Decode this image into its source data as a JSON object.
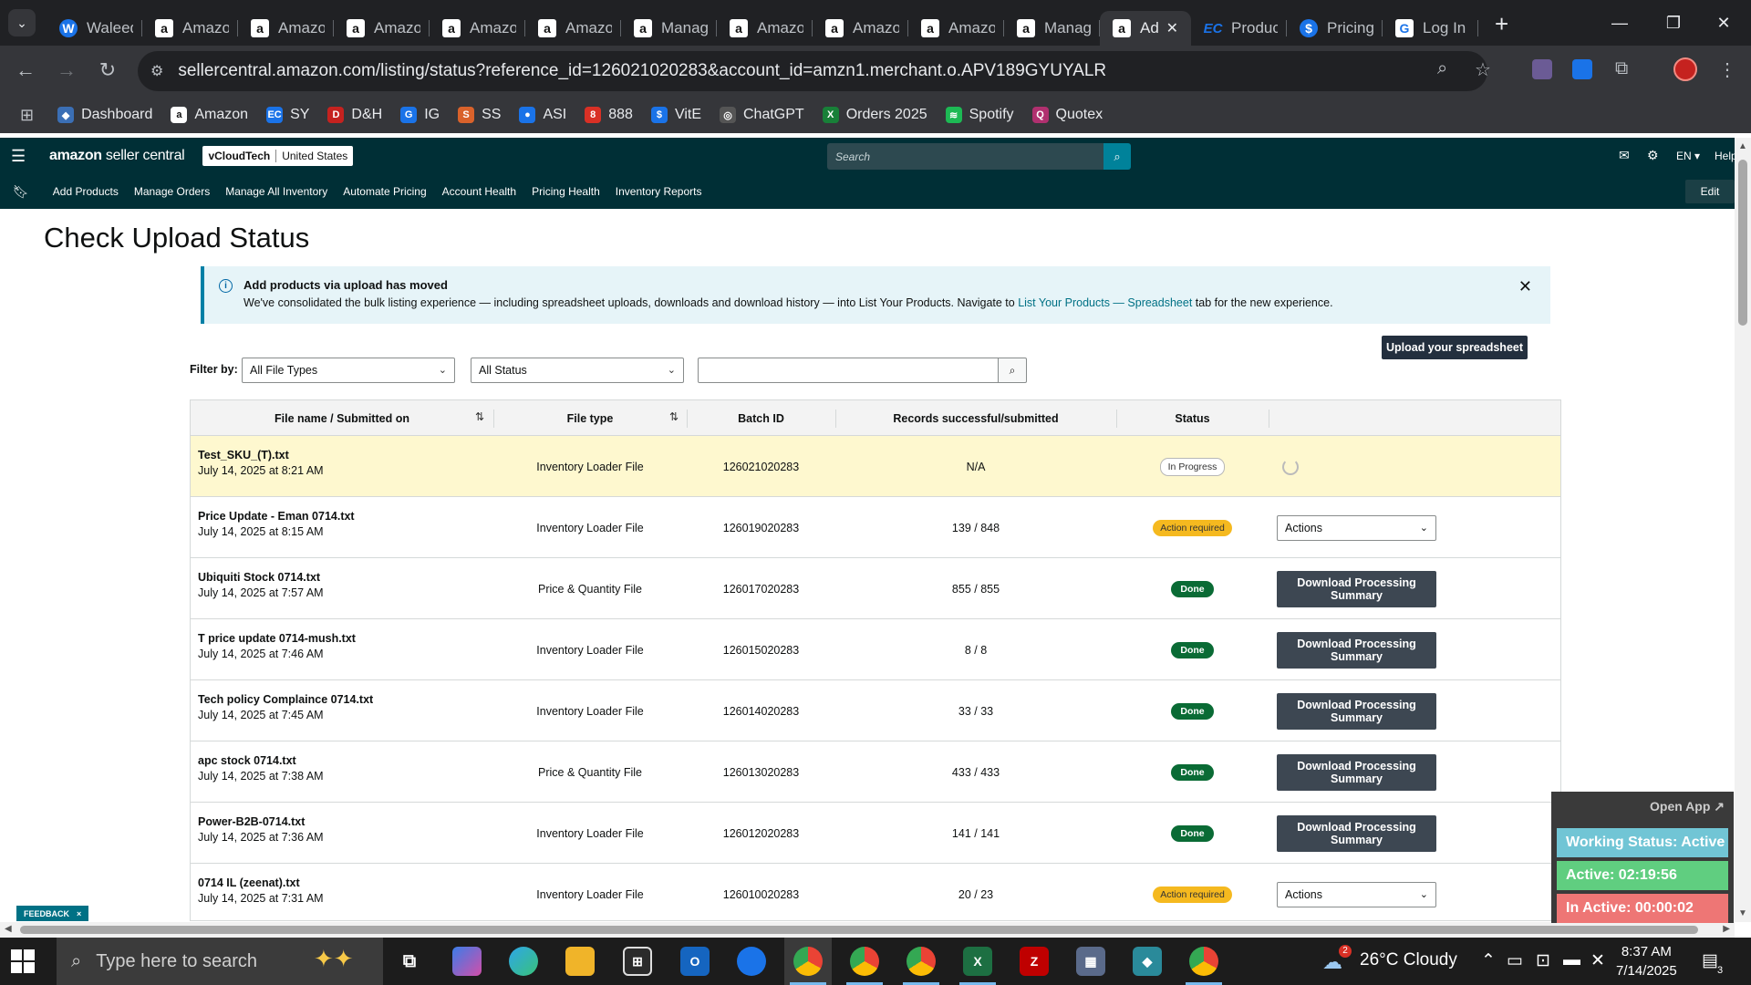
{
  "browser": {
    "tabs": [
      {
        "label": "Waleed",
        "fav": "W",
        "kind": "wal"
      },
      {
        "label": "Amazon",
        "fav": "a",
        "kind": "amz"
      },
      {
        "label": "Amazon",
        "fav": "a",
        "kind": "amz"
      },
      {
        "label": "Amazon",
        "fav": "a",
        "kind": "amz"
      },
      {
        "label": "Amazon",
        "fav": "a",
        "kind": "amz"
      },
      {
        "label": "Amazon",
        "fav": "a",
        "kind": "amz"
      },
      {
        "label": "Manag",
        "fav": "a",
        "kind": "amz"
      },
      {
        "label": "Amazon",
        "fav": "a",
        "kind": "amz"
      },
      {
        "label": "Amazon",
        "fav": "a",
        "kind": "amz"
      },
      {
        "label": "Amazon",
        "fav": "a",
        "kind": "amz"
      },
      {
        "label": "Manag",
        "fav": "a",
        "kind": "amz"
      },
      {
        "label": "Ad",
        "fav": "a",
        "kind": "amz",
        "active": true
      },
      {
        "label": "Produc",
        "fav": "EC",
        "kind": "ec"
      },
      {
        "label": "Pricing",
        "fav": "$",
        "kind": "pr"
      },
      {
        "label": "Log In",
        "fav": "G",
        "kind": "log"
      }
    ],
    "url": "sellercentral.amazon.com/listing/status?reference_id=126021020283&account_id=amzn1.merchant.o.APV189GYUYALR",
    "bookmarks": [
      {
        "label": "Dashboard",
        "color": "#3b6fb5",
        "glyph": "◆"
      },
      {
        "label": "Amazon",
        "color": "#fff",
        "glyph": "a"
      },
      {
        "label": "SY",
        "color": "#1a73e8",
        "glyph": "EC"
      },
      {
        "label": "D&H",
        "color": "#c5221f",
        "glyph": "D"
      },
      {
        "label": "IG",
        "color": "#1a73e8",
        "glyph": "G"
      },
      {
        "label": "SS",
        "color": "#d9622b",
        "glyph": "S"
      },
      {
        "label": "ASI",
        "color": "#1a73e8",
        "glyph": "●"
      },
      {
        "label": "888",
        "color": "#d93025",
        "glyph": "8"
      },
      {
        "label": "VitE",
        "color": "#1a73e8",
        "glyph": "$"
      },
      {
        "label": "ChatGPT",
        "color": "#555",
        "glyph": "◎"
      },
      {
        "label": "Orders 2025",
        "color": "#188038",
        "glyph": "X"
      },
      {
        "label": "Spotify",
        "color": "#1db954",
        "glyph": "≋"
      },
      {
        "label": "Quotex",
        "color": "#b0306f",
        "glyph": "Q"
      }
    ]
  },
  "seller_central": {
    "logo_bold": "amazon",
    "logo_rest": " seller central",
    "store_name": "vCloudTech",
    "marketplace": "United States",
    "search_placeholder": "Search",
    "language": "EN ▾",
    "help": "Help",
    "nav": [
      "Add Products",
      "Manage Orders",
      "Manage All Inventory",
      "Automate Pricing",
      "Account Health",
      "Pricing Health",
      "Inventory Reports"
    ],
    "edit": "Edit"
  },
  "page": {
    "title": "Check Upload Status",
    "banner": {
      "title": "Add products via upload has moved",
      "text_before": "We've consolidated the bulk listing experience — including spreadsheet uploads, downloads and download history — into List Your Products. Navigate to ",
      "link": "List Your Products — Spreadsheet",
      "text_after": " tab for the new experience."
    },
    "filter_label": "Filter by:",
    "file_type_select": "All File Types",
    "status_select": "All Status",
    "search_value": "",
    "upload_button": "Upload your spreadsheet",
    "columns": [
      "File name / Submitted on",
      "File type",
      "Batch ID",
      "Records successful/submitted",
      "Status"
    ],
    "rows": [
      {
        "file": "Test_SKU_(T).txt",
        "date": "July 14, 2025 at 8:21 AM",
        "type": "Inventory Loader File",
        "batch": "126021020283",
        "records": "N/A",
        "status": "In Progress",
        "status_kind": "progress",
        "action": "spinner",
        "highlight": true
      },
      {
        "file": "Price Update - Eman 0714.txt",
        "date": "July 14, 2025 at 8:15 AM",
        "type": "Inventory Loader File",
        "batch": "126019020283",
        "records": "139 / 848",
        "status": "Action required",
        "status_kind": "action",
        "action": "Actions"
      },
      {
        "file": "Ubiquiti Stock 0714.txt",
        "date": "July 14, 2025 at 7:57 AM",
        "type": "Price & Quantity File",
        "batch": "126017020283",
        "records": "855 / 855",
        "status": "Done",
        "status_kind": "done",
        "action": "Download Processing Summary"
      },
      {
        "file": "T price update 0714-mush.txt",
        "date": "July 14, 2025 at 7:46 AM",
        "type": "Inventory Loader File",
        "batch": "126015020283",
        "records": "8 / 8",
        "status": "Done",
        "status_kind": "done",
        "action": "Download Processing Summary"
      },
      {
        "file": "Tech policy Complaince 0714.txt",
        "date": "July 14, 2025 at 7:45 AM",
        "type": "Inventory Loader File",
        "batch": "126014020283",
        "records": "33 / 33",
        "status": "Done",
        "status_kind": "done",
        "action": "Download Processing Summary"
      },
      {
        "file": "apc stock 0714.txt",
        "date": "July 14, 2025 at 7:38 AM",
        "type": "Price & Quantity File",
        "batch": "126013020283",
        "records": "433 / 433",
        "status": "Done",
        "status_kind": "done",
        "action": "Download Processing Summary"
      },
      {
        "file": "Power-B2B-0714.txt",
        "date": "July 14, 2025 at 7:36 AM",
        "type": "Inventory Loader File",
        "batch": "126012020283",
        "records": "141 / 141",
        "status": "Done",
        "status_kind": "done",
        "action": "Download Processing Summary"
      },
      {
        "file": "0714 IL (zeenat).txt",
        "date": "July 14, 2025 at 7:31 AM",
        "type": "Inventory Loader File",
        "batch": "126010020283",
        "records": "20 / 23",
        "status": "Action required",
        "status_kind": "action",
        "action": "Actions"
      }
    ],
    "feedback": "FEEDBACK",
    "feedback_close": "×"
  },
  "tracker": {
    "open_app": "Open App ↗",
    "working": "Working Status: Active",
    "active": "Active: 02:19:56",
    "inactive": "In Active: 00:00:02"
  },
  "taskbar": {
    "search_placeholder": "Type here to search",
    "weather": "26°C  Cloudy",
    "weather_badge": "2",
    "time": "8:37 AM",
    "date": "7/14/2025",
    "notif_count": "3"
  }
}
